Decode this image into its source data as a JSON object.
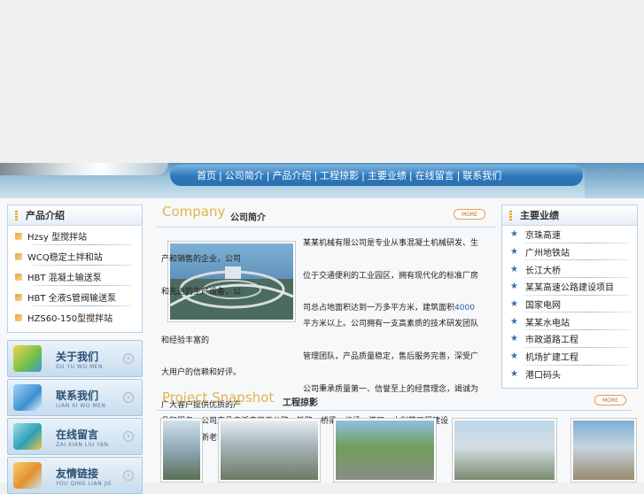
{
  "nav": {
    "items": [
      "首页",
      "公司简介",
      "产品介绍",
      "工程掠影",
      "主要业绩",
      "在线留言",
      "联系我们"
    ]
  },
  "products": {
    "title": "产品介绍",
    "items": [
      "Hzsy 型搅拌站",
      "WCQ稳定土拌和站",
      "HBT 混凝土输送泵",
      "HBT 全液S管阀输送泵",
      "HZS60-150型搅拌站"
    ]
  },
  "menu": [
    {
      "cn": "关于我们",
      "py": "GU YU WO MEN"
    },
    {
      "cn": "联系我们",
      "py": "LIAN XI WO MEN"
    },
    {
      "cn": "在线留言",
      "py": "ZAI XIAN LIU YAN"
    },
    {
      "cn": "友情链接",
      "py": "YOU QING LIAN JIE"
    }
  ],
  "company": {
    "title_en": "Company",
    "title_cn": "公司简介",
    "more": "MORE",
    "intro_lines": [
      "某某机械有限公司是专业从事混凝土机械研发、生产和销售的企业，公司",
      "位于交通便利的工业园区，拥有现代化的标准厂房和先进的生产设备，公",
      "司总占地面积达到一万多平方米，建筑面积",
      "平方米以上。公司拥有一支高素质的技术研发团队和经验丰富的",
      "管理团队，产品质量稳定，售后服务完善，深受广大用户的信赖和好评。",
      "公司秉承质量第一、信誉至上的经营理念，竭诚为广大客户提供优质的产",
      "品和服务。公司产品广泛应用于公路、铁路、桥梁、机场、港口、水利等工程建设",
      "领域，欢迎新老客户洽谈合作。"
    ],
    "area_number": "4000"
  },
  "achievements": {
    "title": "主要业绩",
    "items": [
      "京珠高速",
      "广州地铁站",
      "长江大桥",
      "某某高速公路建设项目",
      "国家电网",
      "某某水电站",
      "市政道路工程",
      "机场扩建工程",
      "港口码头"
    ]
  },
  "project": {
    "title_en": "Project Snapshot",
    "title_cn": "工程掠影",
    "more": "MORE"
  }
}
